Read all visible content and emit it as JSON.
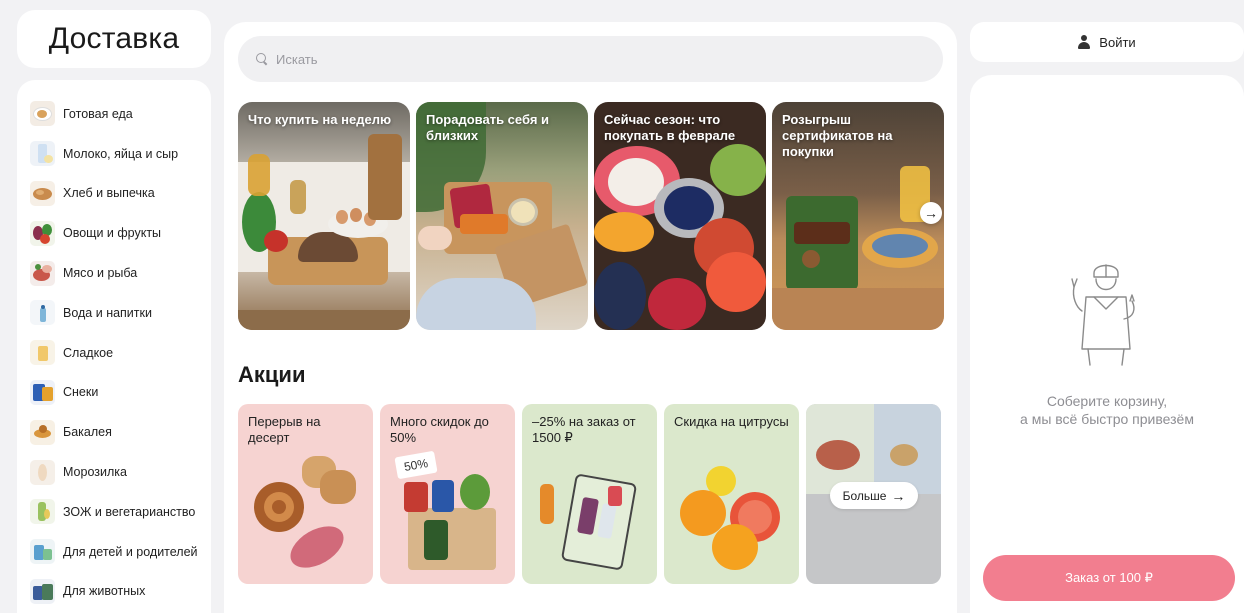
{
  "app": {
    "logo_text": "Доставка"
  },
  "categories": [
    {
      "label": "Готовая еда",
      "icon": "ready-meal-icon"
    },
    {
      "label": "Молоко, яйца и сыр",
      "icon": "milk-icon"
    },
    {
      "label": "Хлеб и выпечка",
      "icon": "bread-icon"
    },
    {
      "label": "Овощи и фрукты",
      "icon": "vegetables-icon"
    },
    {
      "label": "Мясо и рыба",
      "icon": "meat-icon"
    },
    {
      "label": "Вода и напитки",
      "icon": "water-icon"
    },
    {
      "label": "Сладкое",
      "icon": "sweets-icon"
    },
    {
      "label": "Снеки",
      "icon": "snacks-icon"
    },
    {
      "label": "Бакалея",
      "icon": "grocery-icon"
    },
    {
      "label": "Морозилка",
      "icon": "frozen-icon"
    },
    {
      "label": "ЗОЖ и вегетарианство",
      "icon": "healthy-icon"
    },
    {
      "label": "Для детей и родителей",
      "icon": "kids-icon"
    },
    {
      "label": "Для животных",
      "icon": "pets-icon"
    }
  ],
  "search": {
    "placeholder": "Искать"
  },
  "stories": [
    {
      "title": "Что купить на неделю"
    },
    {
      "title": "Порадовать себя и близких"
    },
    {
      "title": "Сейчас сезон: что покупать в феврале"
    },
    {
      "title": "Розыгрыш сертификатов на покупки"
    }
  ],
  "promotions": {
    "heading": "Акции",
    "cards": [
      {
        "title": "Перерыв на десерт"
      },
      {
        "title": "Много скидок до 50%",
        "badge": "50%"
      },
      {
        "title": "–25% на заказ от 1500 ₽"
      },
      {
        "title": "Скидка на цитрусы"
      }
    ],
    "more_label": "Больше",
    "more_arrow": "→"
  },
  "header": {
    "login_label": "Войти"
  },
  "cart": {
    "empty_text": "Соберите корзину,\nа мы всё быстро привезём",
    "order_button_label": "Заказ от 100 ₽"
  },
  "colors": {
    "accent": "#f27e8f",
    "page_bg": "#f2f2f4"
  }
}
